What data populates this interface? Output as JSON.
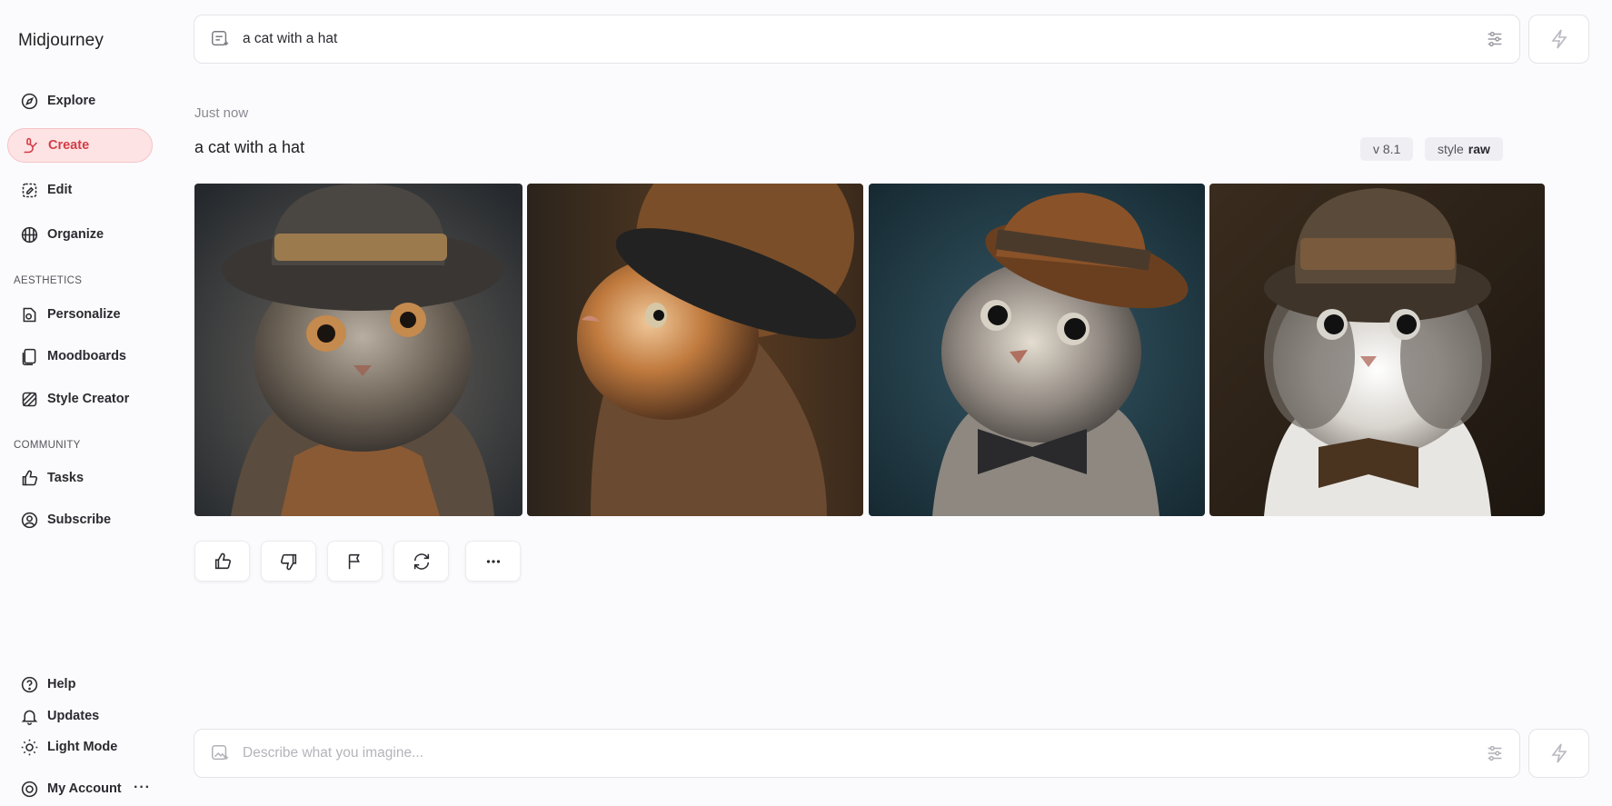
{
  "app": {
    "name": "Midjourney"
  },
  "sidebar": {
    "nav": [
      {
        "label": "Explore",
        "icon": "compass-icon"
      },
      {
        "label": "Create",
        "icon": "brush-icon",
        "active": true
      },
      {
        "label": "Edit",
        "icon": "edit-icon"
      },
      {
        "label": "Organize",
        "icon": "grid-icon"
      }
    ],
    "aesthetics_label": "AESTHETICS",
    "aesthetics": [
      {
        "label": "Personalize",
        "icon": "personalize-icon"
      },
      {
        "label": "Moodboards",
        "icon": "moodboard-icon"
      },
      {
        "label": "Style Creator",
        "icon": "style-creator-icon"
      }
    ],
    "community_label": "COMMUNITY",
    "community": [
      {
        "label": "Tasks",
        "icon": "thumbs-up-icon"
      },
      {
        "label": "Subscribe",
        "icon": "user-circle-icon"
      }
    ],
    "footer": [
      {
        "label": "Help",
        "icon": "help-icon"
      },
      {
        "label": "Updates",
        "icon": "bell-icon"
      },
      {
        "label": "Light Mode",
        "icon": "sun-icon"
      },
      {
        "label": "My Account",
        "icon": "account-icon"
      }
    ],
    "more": "···"
  },
  "top_prompt": {
    "value": "a cat with a hat"
  },
  "job": {
    "time": "Just now",
    "prompt": "a cat with a hat",
    "version_tag": "v 8.1",
    "style_tag_key": "style",
    "style_tag_value": "raw",
    "images": [
      {
        "alt": "cat in grey top hat"
      },
      {
        "alt": "orange cat in black hat"
      },
      {
        "alt": "grey cat in brown hat with bow tie"
      },
      {
        "alt": "white cat in top hat with bow tie"
      }
    ],
    "actions": [
      "thumbs-up-icon",
      "thumbs-down-icon",
      "flag-icon",
      "refresh-icon",
      "more-icon"
    ]
  },
  "bottom_prompt": {
    "placeholder": "Describe what you imagine..."
  },
  "colors": {
    "accent": "#d43c46",
    "accent_bg": "#fde3e4",
    "background": "#fbfbfd"
  }
}
